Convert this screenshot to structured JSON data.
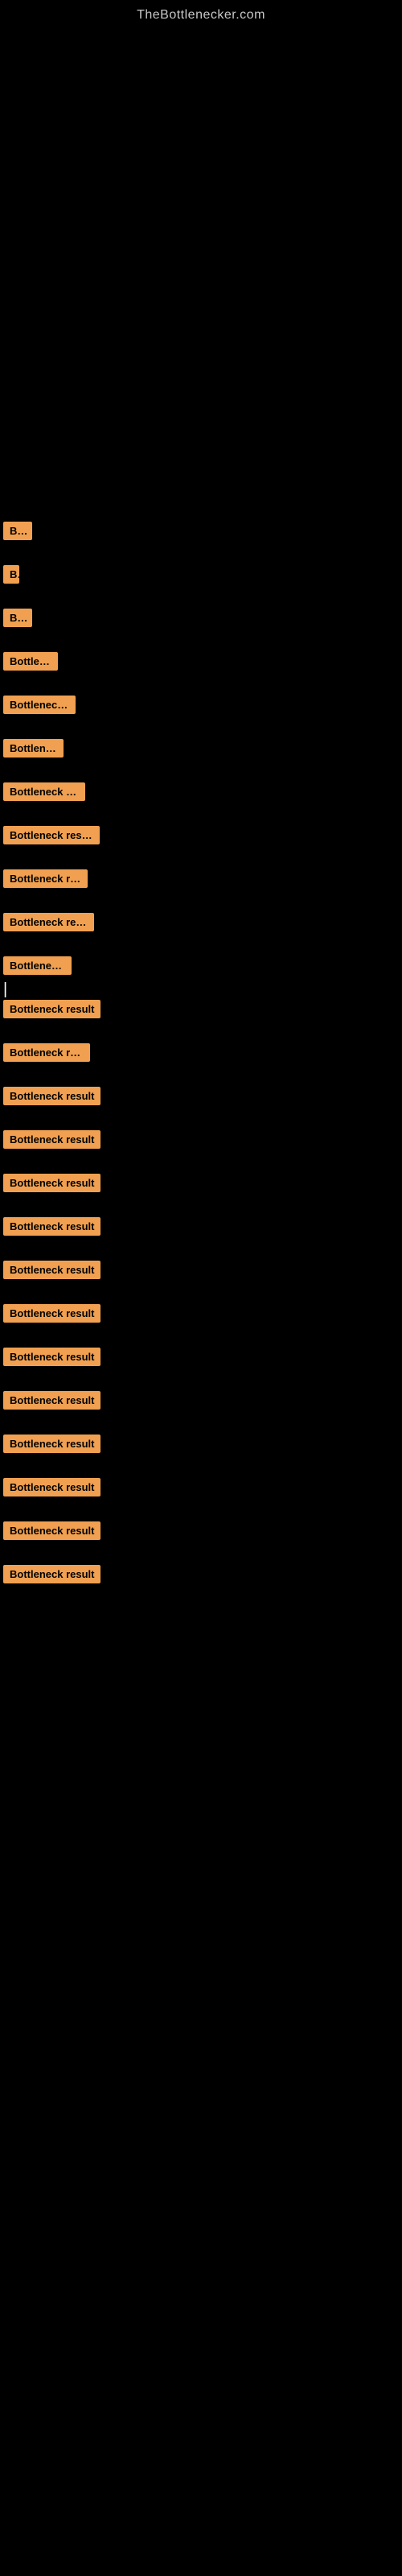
{
  "site": {
    "title": "TheBottlenecker.com"
  },
  "cursor": "|",
  "results": [
    {
      "id": 1,
      "label": "Bottleneck result"
    },
    {
      "id": 2,
      "label": "Bottleneck result"
    },
    {
      "id": 3,
      "label": "Bottleneck result"
    },
    {
      "id": 4,
      "label": "Bottleneck result"
    },
    {
      "id": 5,
      "label": "Bottleneck result"
    },
    {
      "id": 6,
      "label": "Bottleneck result"
    },
    {
      "id": 7,
      "label": "Bottleneck result"
    },
    {
      "id": 8,
      "label": "Bottleneck result"
    },
    {
      "id": 9,
      "label": "Bottleneck result"
    },
    {
      "id": 10,
      "label": "Bottleneck result"
    },
    {
      "id": 11,
      "label": "Bottleneck result"
    },
    {
      "id": 12,
      "label": "Bottleneck result"
    },
    {
      "id": 13,
      "label": "Bottleneck result"
    },
    {
      "id": 14,
      "label": "Bottleneck result"
    },
    {
      "id": 15,
      "label": "Bottleneck result"
    },
    {
      "id": 16,
      "label": "Bottleneck result"
    },
    {
      "id": 17,
      "label": "Bottleneck result"
    },
    {
      "id": 18,
      "label": "Bottleneck result"
    },
    {
      "id": 19,
      "label": "Bottleneck result"
    },
    {
      "id": 20,
      "label": "Bottleneck result"
    },
    {
      "id": 21,
      "label": "Bottleneck result"
    },
    {
      "id": 22,
      "label": "Bottleneck result"
    },
    {
      "id": 23,
      "label": "Bottleneck result"
    },
    {
      "id": 24,
      "label": "Bottleneck result"
    },
    {
      "id": 25,
      "label": "Bottleneck result"
    }
  ]
}
